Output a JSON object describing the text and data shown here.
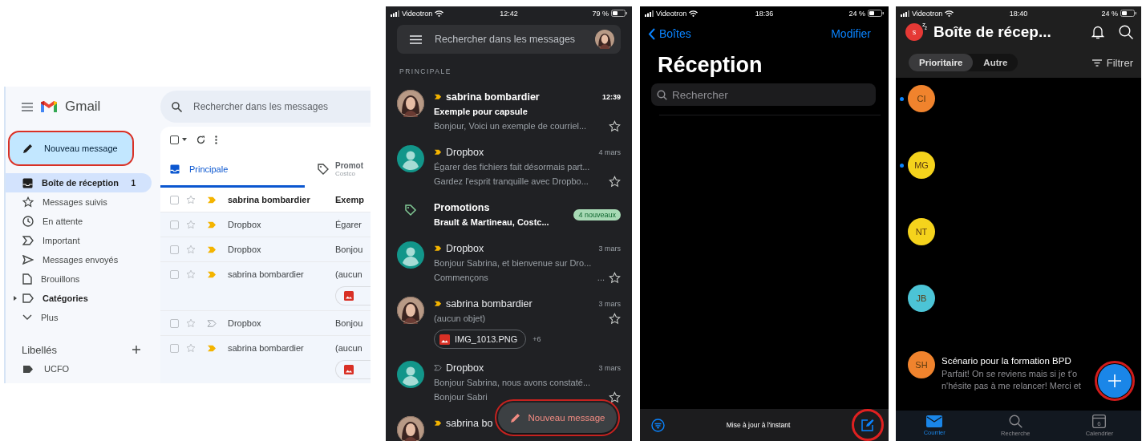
{
  "gmail_web": {
    "logo_text": "Gmail",
    "search": {
      "placeholder": "Rechercher dans les messages"
    },
    "compose": {
      "label": "Nouveau message",
      "highlighted": true
    },
    "nav": [
      {
        "kind": "inbox",
        "label": "Boîte de réception",
        "count": "1",
        "selected": true,
        "bold": true,
        "expandable": false
      },
      {
        "kind": "star",
        "label": "Messages suivis",
        "selected": false,
        "bold": false,
        "expandable": false
      },
      {
        "kind": "clock",
        "label": "En attente",
        "selected": false,
        "bold": false,
        "expandable": false
      },
      {
        "kind": "important",
        "label": "Important",
        "selected": false,
        "bold": false,
        "expandable": false
      },
      {
        "kind": "send",
        "label": "Messages envoyés",
        "selected": false,
        "bold": false,
        "expandable": false
      },
      {
        "kind": "draft",
        "label": "Brouillons",
        "selected": false,
        "bold": false,
        "expandable": false
      },
      {
        "kind": "label",
        "label": "Catégories",
        "selected": false,
        "bold": true,
        "expandable": true
      },
      {
        "kind": "more",
        "label": "Plus",
        "selected": false,
        "bold": false,
        "expandable": false
      }
    ],
    "labels_title": "Libellés",
    "labels": [
      {
        "label": "UCFO"
      }
    ],
    "toolbar": {
      "checked": false
    },
    "tabs": [
      {
        "kind": "inbox",
        "label": "Principale",
        "selected": true
      },
      {
        "kind": "tag",
        "label": "Promot",
        "subtitle": "Costco",
        "selected": false
      }
    ],
    "rows": [
      {
        "sender": "sabrina bombardier",
        "subject": "Exemp",
        "checked": false,
        "unread": true,
        "important": true,
        "attachment": false
      },
      {
        "sender": "Dropbox",
        "subject": "Égarer",
        "checked": false,
        "unread": false,
        "important": true,
        "attachment": false
      },
      {
        "sender": "Dropbox",
        "subject": "Bonjou",
        "checked": false,
        "unread": false,
        "important": true,
        "attachment": false
      },
      {
        "sender": "sabrina bombardier",
        "subject": "(aucun",
        "checked": false,
        "unread": false,
        "important": true,
        "attachment": true
      },
      {
        "sender": "Dropbox",
        "subject": "Bonjou",
        "checked": false,
        "unread": false,
        "important": false,
        "attachment": false
      },
      {
        "sender": "sabrina bombardier",
        "subject": "(aucun",
        "checked": false,
        "unread": false,
        "important": true,
        "attachment": true
      }
    ]
  },
  "gmail_mobile": {
    "status": {
      "carrier": "Videotron",
      "time": "12:42",
      "battery": "79 %"
    },
    "search": {
      "placeholder": "Rechercher dans les messages"
    },
    "section": "PRINCIPALE",
    "messages": [
      {
        "kind": "mail",
        "photo": true,
        "sender": "sabrina bombardier",
        "time": "12:39",
        "subject": "Exemple pour capsule",
        "lines": [
          "Bonjour, Voici un exemple de courriel..."
        ],
        "unread": true,
        "important": true,
        "starred": false
      },
      {
        "kind": "mail",
        "photo": false,
        "sender": "Dropbox",
        "time": "4 mars",
        "lines": [
          "Égarer des fichiers fait désormais part...",
          "Gardez l'esprit tranquille avec Dropbo..."
        ],
        "unread": false,
        "important": true,
        "starred": false
      },
      {
        "kind": "bundle",
        "title": "Promotions",
        "senders": "Brault & Martineau, Costc...",
        "badge": "4 nouveaux"
      },
      {
        "kind": "mail",
        "photo": false,
        "sender": "Dropbox",
        "time": "3 mars",
        "lines": [
          "Bonjour Sabrina, et bienvenue sur Dro...",
          "Commençons"
        ],
        "trailing": "...",
        "unread": false,
        "important": true,
        "starred": false
      },
      {
        "kind": "mail",
        "photo": true,
        "sender": "sabrina bombardier",
        "time": "3 mars",
        "lines": [
          "(aucun objet)"
        ],
        "attachment": {
          "name": "IMG_1013.PNG",
          "more": "+6"
        },
        "unread": false,
        "important": true,
        "starred": false
      },
      {
        "kind": "mail",
        "photo": false,
        "sender": "Dropbox",
        "time": "3 mars",
        "lines": [
          "Bonjour Sabrina, nous avons constaté...",
          "Bonjour Sabri"
        ],
        "unread": false,
        "important": false,
        "starred": false
      },
      {
        "kind": "mail",
        "photo": true,
        "sender": "sabrina bo",
        "unread": false,
        "important": true
      }
    ],
    "compose": {
      "label": "Nouveau message",
      "highlighted": true
    }
  },
  "apple_mail": {
    "status": {
      "carrier": "Videotron",
      "time": "18:36",
      "battery": "24 %"
    },
    "back": "Boîtes",
    "action": "Modifier",
    "title": "Réception",
    "search": {
      "placeholder": "Rechercher"
    },
    "status_text": "Mise à jour à l'instant",
    "compose": {
      "highlighted": true
    }
  },
  "outlook": {
    "status": {
      "carrier": "Videotron",
      "time": "18:40",
      "battery": "24 %"
    },
    "account": "s",
    "title": "Boîte de récep...",
    "tabs": [
      {
        "label": "Prioritaire",
        "selected": true
      },
      {
        "label": "Autre",
        "selected": false
      }
    ],
    "filter": "Filtrer",
    "messages": [
      {
        "initials": "CI",
        "color": "#f0832d",
        "unread": true
      },
      {
        "initials": "MG",
        "color": "#f5d31c",
        "unread": true
      },
      {
        "initials": "NT",
        "color": "#f5d31c",
        "unread": false
      },
      {
        "initials": "JB",
        "color": "#4cc4d6",
        "unread": false
      },
      {
        "initials": "SH",
        "color": "#f0832d",
        "unread": false,
        "subject": "Scénario pour la formation BPD",
        "preview": [
          "Parfait! On se reviens mais si je t'o",
          "n'hésite pas à me relancer! Merci et"
        ]
      }
    ],
    "fab": {
      "highlighted": true
    },
    "nav": [
      {
        "kind": "mail",
        "label": "Courrier",
        "selected": true
      },
      {
        "kind": "search",
        "label": "Recherche",
        "selected": false
      },
      {
        "kind": "calendar",
        "label": "Calendrier",
        "day": "6",
        "selected": false
      }
    ]
  }
}
